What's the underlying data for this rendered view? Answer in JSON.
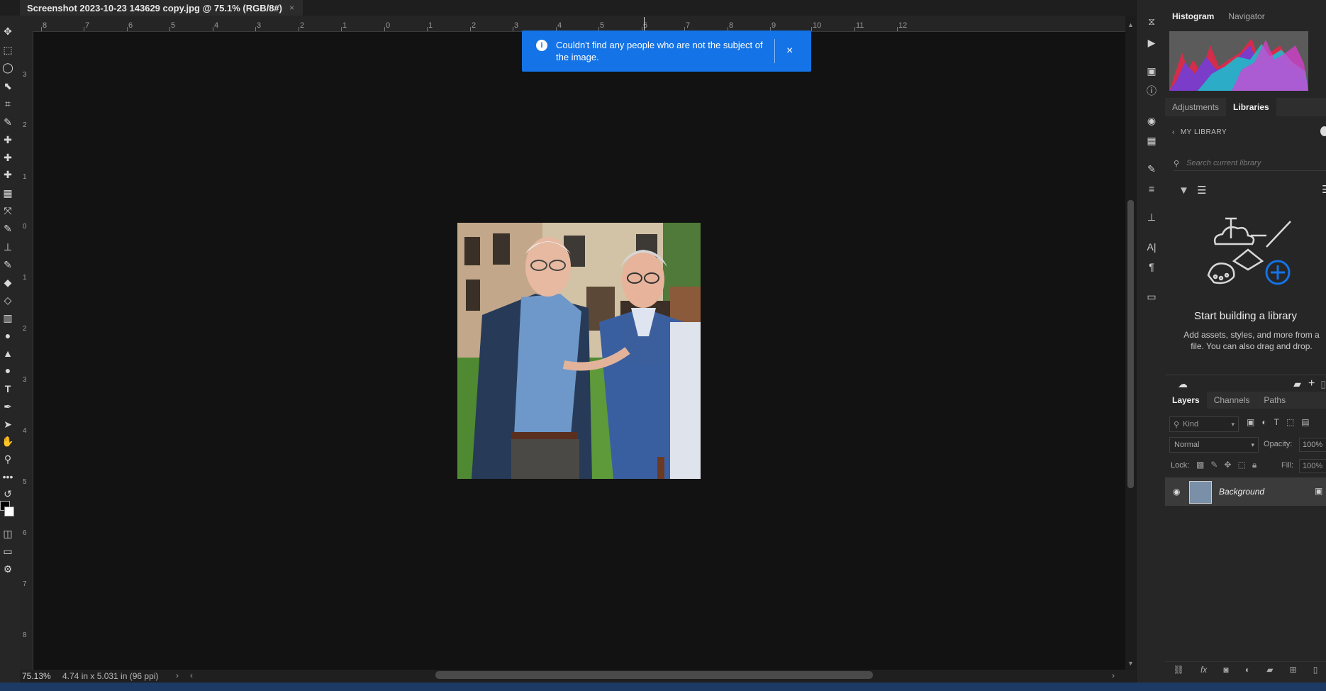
{
  "document_tab": {
    "title": "Screenshot 2023-10-23 143629 copy.jpg @ 75.1% (RGB/8#)",
    "close": "×"
  },
  "ruler": {
    "top_labels": [
      "8",
      "7",
      "6",
      "5",
      "4",
      "3",
      "2",
      "1",
      "0",
      "1",
      "2",
      "3",
      "4",
      "5",
      "6",
      "7",
      "8",
      "9",
      "10",
      "11",
      "12"
    ],
    "left_labels": [
      "3",
      "2",
      "1",
      "0",
      "1",
      "2",
      "3",
      "4",
      "5",
      "6",
      "7",
      "8"
    ]
  },
  "notification": {
    "text": "Couldn't find any people who are not the subject of the image.",
    "info_icon": "i",
    "close": "×"
  },
  "status_bar": {
    "zoom": "75.13%",
    "doc_info": "4.74 in x 5.031 in (96 ppi)"
  },
  "panels": {
    "top_tabs": [
      "Histogram",
      "Navigator"
    ],
    "mid_tabs": [
      "Adjustments",
      "Libraries"
    ],
    "library": {
      "back_label": "MY LIBRARY",
      "search_placeholder": "Search current library",
      "empty_title": "Start building a library",
      "empty_desc": "Add assets, styles, and more from a file. You can also drag and drop."
    },
    "layers_tabs": [
      "Layers",
      "Channels",
      "Paths"
    ],
    "layers": {
      "kind_placeholder": "Kind",
      "blend_mode": "Normal",
      "opacity_label": "Opacity:",
      "opacity_value": "100%",
      "lock_label": "Lock:",
      "fill_label": "Fill:",
      "fill_value": "100%",
      "layer_name": "Background"
    }
  },
  "colors": {
    "accent": "#1473e6",
    "canvas": "#121212",
    "panel": "#262626"
  }
}
